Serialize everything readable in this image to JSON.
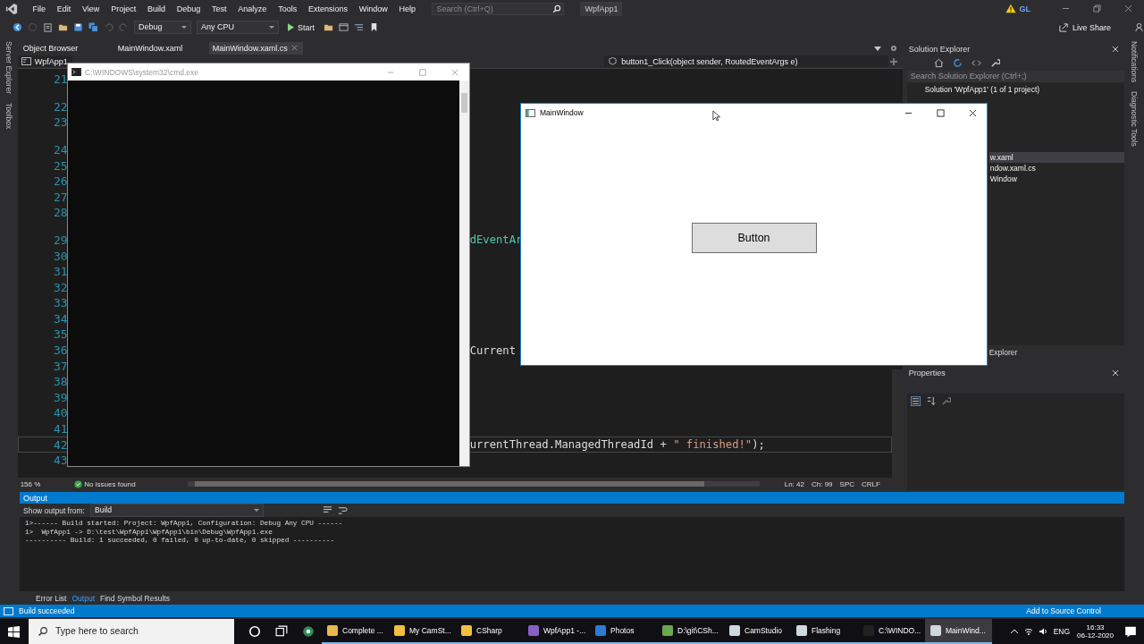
{
  "ide": {
    "menu": [
      "File",
      "Edit",
      "View",
      "Project",
      "Build",
      "Debug",
      "Test",
      "Analyze",
      "Tools",
      "Extensions",
      "Window",
      "Help"
    ],
    "search": {
      "placeholder": "Search (Ctrl+Q)"
    },
    "solution_name": "WpfApp1",
    "account": "GL",
    "toolbar": {
      "configuration": "Debug",
      "platform": "Any CPU",
      "start": "Start",
      "live_share": "Live Share"
    },
    "left_strip": [
      "Server Explorer",
      "Toolbox"
    ],
    "doc_tabs": [
      {
        "label": "Object Browser",
        "selected": false
      },
      {
        "label": "MainWindow.xaml",
        "selected": false
      },
      {
        "label": "MainWindow.xaml.cs",
        "selected": true
      }
    ],
    "nav_bar": {
      "project": "WpfApp1",
      "member": "button1_Click(object sender, RoutedEventArgs e)"
    },
    "code_lines": [
      {
        "num": "21",
        "lens": false,
        "current": false
      },
      {
        "num": "22",
        "lens": true,
        "current": false
      },
      {
        "num": "23",
        "lens": false,
        "current": false
      },
      {
        "num": "24",
        "lens": true,
        "current": false
      },
      {
        "num": "25",
        "lens": false,
        "current": false
      },
      {
        "num": "26",
        "lens": false,
        "current": false
      },
      {
        "num": "27",
        "lens": false,
        "current": false
      },
      {
        "num": "28",
        "lens": false,
        "current": false
      },
      {
        "num": "29",
        "lens": true,
        "current": false,
        "code": [
          {
            "text": "dEventAr",
            "kind": "type"
          }
        ]
      },
      {
        "num": "30",
        "lens": false,
        "current": false
      },
      {
        "num": "31",
        "lens": false,
        "current": false
      },
      {
        "num": "32",
        "lens": false,
        "current": false
      },
      {
        "num": "33",
        "lens": false,
        "current": false
      },
      {
        "num": "34",
        "lens": false,
        "current": false
      },
      {
        "num": "35",
        "lens": false,
        "current": false
      },
      {
        "num": "36",
        "lens": false,
        "current": false,
        "code": [
          {
            "text": "Current",
            "kind": "plain"
          }
        ]
      },
      {
        "num": "37",
        "lens": false,
        "current": false
      },
      {
        "num": "38",
        "lens": false,
        "current": false
      },
      {
        "num": "39",
        "lens": false,
        "current": false
      },
      {
        "num": "40",
        "lens": false,
        "current": false
      },
      {
        "num": "41",
        "lens": false,
        "current": false
      },
      {
        "num": "42",
        "lens": false,
        "current": true,
        "code": [
          {
            "text": "urrentThread.ManagedThreadId + ",
            "kind": "plain"
          },
          {
            "text": "\" finished!\"",
            "kind": "string"
          },
          {
            "text": ");",
            "kind": "plain"
          }
        ]
      },
      {
        "num": "43",
        "lens": false,
        "current": false
      }
    ],
    "editor_status": {
      "zoom": "156 %",
      "issues": "No issues found",
      "line": "Ln: 42",
      "col": "Ch: 99",
      "spacing": "SPC",
      "eol": "CRLF"
    },
    "solution_explorer": {
      "title": "Solution Explorer",
      "search": {
        "placeholder": "Search Solution Explorer (Ctrl+;)"
      },
      "items": [
        {
          "label": "Solution 'WpfApp1' (1 of 1 project)",
          "kind": "root",
          "selected": false
        },
        {
          "label": "w.xaml",
          "kind": "cut",
          "selected": true
        },
        {
          "label": "ndow.xaml.cs",
          "kind": "cut",
          "selected": false
        },
        {
          "label": "Window",
          "kind": "cut",
          "selected": false
        }
      ],
      "bottom_tab": "Explorer"
    },
    "properties": {
      "title": "Properties"
    },
    "right_strip": [
      "Notifications",
      "Diagnostic Tools"
    ],
    "output": {
      "title": "Output",
      "source_label": "Show output from:",
      "source": "Build",
      "lines": [
        "1>------ Build started: Project: WpfApp1, Configuration: Debug Any CPU ------",
        "1>  WpfApp1 -> D:\\test\\WpfApp1\\WpfApp1\\bin\\Debug\\WpfApp1.exe",
        "---------- Build: 1 succeeded, 0 failed, 0 up-to-date, 0 skipped ----------"
      ],
      "tabs": [
        {
          "label": "Error List",
          "selected": false
        },
        {
          "label": "Output",
          "selected": true
        },
        {
          "label": "Find Symbol Results",
          "selected": false
        }
      ]
    },
    "status_bar": {
      "message": "Build succeeded",
      "source_control": "Add to Source Control"
    }
  },
  "console_window": {
    "title": "C:\\WINDOWS\\system32\\cmd.exe",
    "active": false
  },
  "app_window": {
    "title": "MainWindow",
    "button": "Button",
    "active": true
  },
  "taskbar": {
    "search": {
      "placeholder": "Type here to search"
    },
    "apps": [
      {
        "label": "Complete ...",
        "selected": false
      },
      {
        "label": "My CamSt...",
        "selected": false
      },
      {
        "label": "CSharp",
        "selected": false
      },
      {
        "label": "WpfApp1 -...",
        "selected": false
      },
      {
        "label": "Photos",
        "selected": false
      },
      {
        "label": "D:\\git\\CSh...",
        "selected": false
      },
      {
        "label": "CamStudio",
        "selected": false
      },
      {
        "label": "Flashing",
        "selected": false
      },
      {
        "label": "C:\\WINDO...",
        "selected": false
      },
      {
        "label": "MainWind...",
        "selected": true
      }
    ],
    "language": "ENG",
    "time": "16:33",
    "date": "06-12-2020"
  }
}
